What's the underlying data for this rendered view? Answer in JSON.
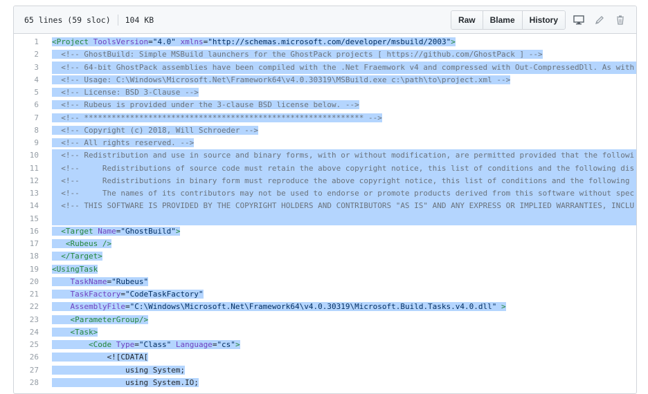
{
  "file": {
    "lines_info": "65 lines (59 sloc)",
    "size": "104 KB",
    "raw_label": "Raw",
    "blame_label": "Blame",
    "history_label": "History"
  },
  "icons": {
    "desktop": "desktop-icon",
    "edit": "pencil-icon",
    "delete": "trash-icon"
  },
  "colors": {
    "selection": "#b4d5fe",
    "tag": "#22863a",
    "attr": "#6f42c1",
    "string": "#032f62",
    "comment": "#6a737d"
  },
  "lines": [
    {
      "n": "1",
      "full": false,
      "tokens": [
        [
          "tag",
          "<Project "
        ],
        [
          "attr",
          "ToolsVersion"
        ],
        [
          "pln",
          "="
        ],
        [
          "str",
          "\"4.0\" "
        ],
        [
          "attr",
          "xmlns"
        ],
        [
          "pln",
          "="
        ],
        [
          "str",
          "\"http://schemas.microsoft.com/developer/msbuild/2003\""
        ],
        [
          "tag",
          ">"
        ]
      ]
    },
    {
      "n": "2",
      "full": false,
      "tokens": [
        [
          "cmt",
          "  <!-- GhostBuild: Simple MSBuild launchers for the GhostPack projects [ https://github.com/GhostPack ] -->"
        ]
      ]
    },
    {
      "n": "3",
      "full": true,
      "tokens": [
        [
          "cmt",
          "  <!-- 64-bit GhostPack assemblies have been compiled with the .Net Fraemwork v4 and compressed with Out-CompressedDll. As with"
        ]
      ]
    },
    {
      "n": "4",
      "full": false,
      "tokens": [
        [
          "cmt",
          "  <!-- Usage: C:\\Windows\\Microsoft.Net\\Framework64\\v4.0.30319\\MSBuild.exe c:\\path\\to\\project.xml -->"
        ]
      ]
    },
    {
      "n": "5",
      "full": false,
      "tokens": [
        [
          "cmt",
          "  <!-- License: BSD 3-Clause -->"
        ]
      ]
    },
    {
      "n": "6",
      "full": false,
      "tokens": [
        [
          "cmt",
          "  <!-- Rubeus is provided under the 3-clause BSD license below. -->"
        ]
      ]
    },
    {
      "n": "7",
      "full": false,
      "tokens": [
        [
          "cmt",
          "  <!-- ************************************************************* -->"
        ]
      ]
    },
    {
      "n": "8",
      "full": false,
      "tokens": [
        [
          "cmt",
          "  <!-- Copyright (c) 2018, Will Schroeder -->"
        ]
      ]
    },
    {
      "n": "9",
      "full": false,
      "tokens": [
        [
          "cmt",
          "  <!-- All rights reserved. -->"
        ]
      ]
    },
    {
      "n": "10",
      "full": true,
      "tokens": [
        [
          "cmt",
          "  <!-- Redistribution and use in source and binary forms, with or without modification, are permitted provided that the followi"
        ]
      ]
    },
    {
      "n": "11",
      "full": true,
      "tokens": [
        [
          "cmt",
          "  <!--     Redistributions of source code must retain the above copyright notice, this list of conditions and the following dis"
        ]
      ]
    },
    {
      "n": "12",
      "full": true,
      "tokens": [
        [
          "cmt",
          "  <!--     Redistributions in binary form must reproduce the above copyright notice, this list of conditions and the following "
        ]
      ]
    },
    {
      "n": "13",
      "full": true,
      "tokens": [
        [
          "cmt",
          "  <!--     The names of its contributors may not be used to endorse or promote products derived from this software without spec"
        ]
      ]
    },
    {
      "n": "14",
      "full": true,
      "tokens": [
        [
          "cmt",
          "  <!-- THIS SOFTWARE IS PROVIDED BY THE COPYRIGHT HOLDERS AND CONTRIBUTORS \"AS IS\" AND ANY EXPRESS OR IMPLIED WARRANTIES, INCLU"
        ]
      ]
    },
    {
      "n": "15",
      "full": true,
      "tokens": [
        [
          "pln",
          " "
        ]
      ]
    },
    {
      "n": "16",
      "full": false,
      "tokens": [
        [
          "tag",
          "  <Target "
        ],
        [
          "attr",
          "Name"
        ],
        [
          "pln",
          "="
        ],
        [
          "str",
          "\"GhostBuild\""
        ],
        [
          "tag",
          ">"
        ]
      ]
    },
    {
      "n": "17",
      "full": false,
      "tokens": [
        [
          "tag",
          "   <Rubeus />"
        ]
      ]
    },
    {
      "n": "18",
      "full": false,
      "tokens": [
        [
          "tag",
          "  </Target>"
        ]
      ]
    },
    {
      "n": "19",
      "full": false,
      "tokens": [
        [
          "tag",
          "<UsingTask"
        ]
      ]
    },
    {
      "n": "20",
      "full": false,
      "tokens": [
        [
          "attr",
          "    TaskName"
        ],
        [
          "pln",
          "="
        ],
        [
          "str",
          "\"Rubeus\""
        ]
      ]
    },
    {
      "n": "21",
      "full": false,
      "tokens": [
        [
          "attr",
          "    TaskFactory"
        ],
        [
          "pln",
          "="
        ],
        [
          "str",
          "\"CodeTaskFactory\""
        ]
      ]
    },
    {
      "n": "22",
      "full": false,
      "tokens": [
        [
          "attr",
          "    AssemblyFile"
        ],
        [
          "pln",
          "="
        ],
        [
          "str",
          "\"C:\\Windows\\Microsoft.Net\\Framework64\\v4.0.30319\\Microsoft.Build.Tasks.v4.0.dll\" "
        ],
        [
          "tag",
          ">"
        ]
      ]
    },
    {
      "n": "23",
      "full": false,
      "tokens": [
        [
          "tag",
          "    <ParameterGroup/>"
        ]
      ]
    },
    {
      "n": "24",
      "full": false,
      "tokens": [
        [
          "tag",
          "    <Task>"
        ]
      ]
    },
    {
      "n": "25",
      "full": false,
      "tokens": [
        [
          "tag",
          "        <Code "
        ],
        [
          "attr",
          "Type"
        ],
        [
          "pln",
          "="
        ],
        [
          "str",
          "\"Class\" "
        ],
        [
          "attr",
          "Language"
        ],
        [
          "pln",
          "="
        ],
        [
          "str",
          "\"cs\""
        ],
        [
          "tag",
          ">"
        ]
      ]
    },
    {
      "n": "26",
      "full": false,
      "tokens": [
        [
          "pln",
          "            <![CDATA["
        ]
      ]
    },
    {
      "n": "27",
      "full": false,
      "tokens": [
        [
          "pln",
          "                using System;"
        ]
      ]
    },
    {
      "n": "28",
      "full": false,
      "tokens": [
        [
          "pln",
          "                using System.IO;"
        ]
      ]
    }
  ]
}
